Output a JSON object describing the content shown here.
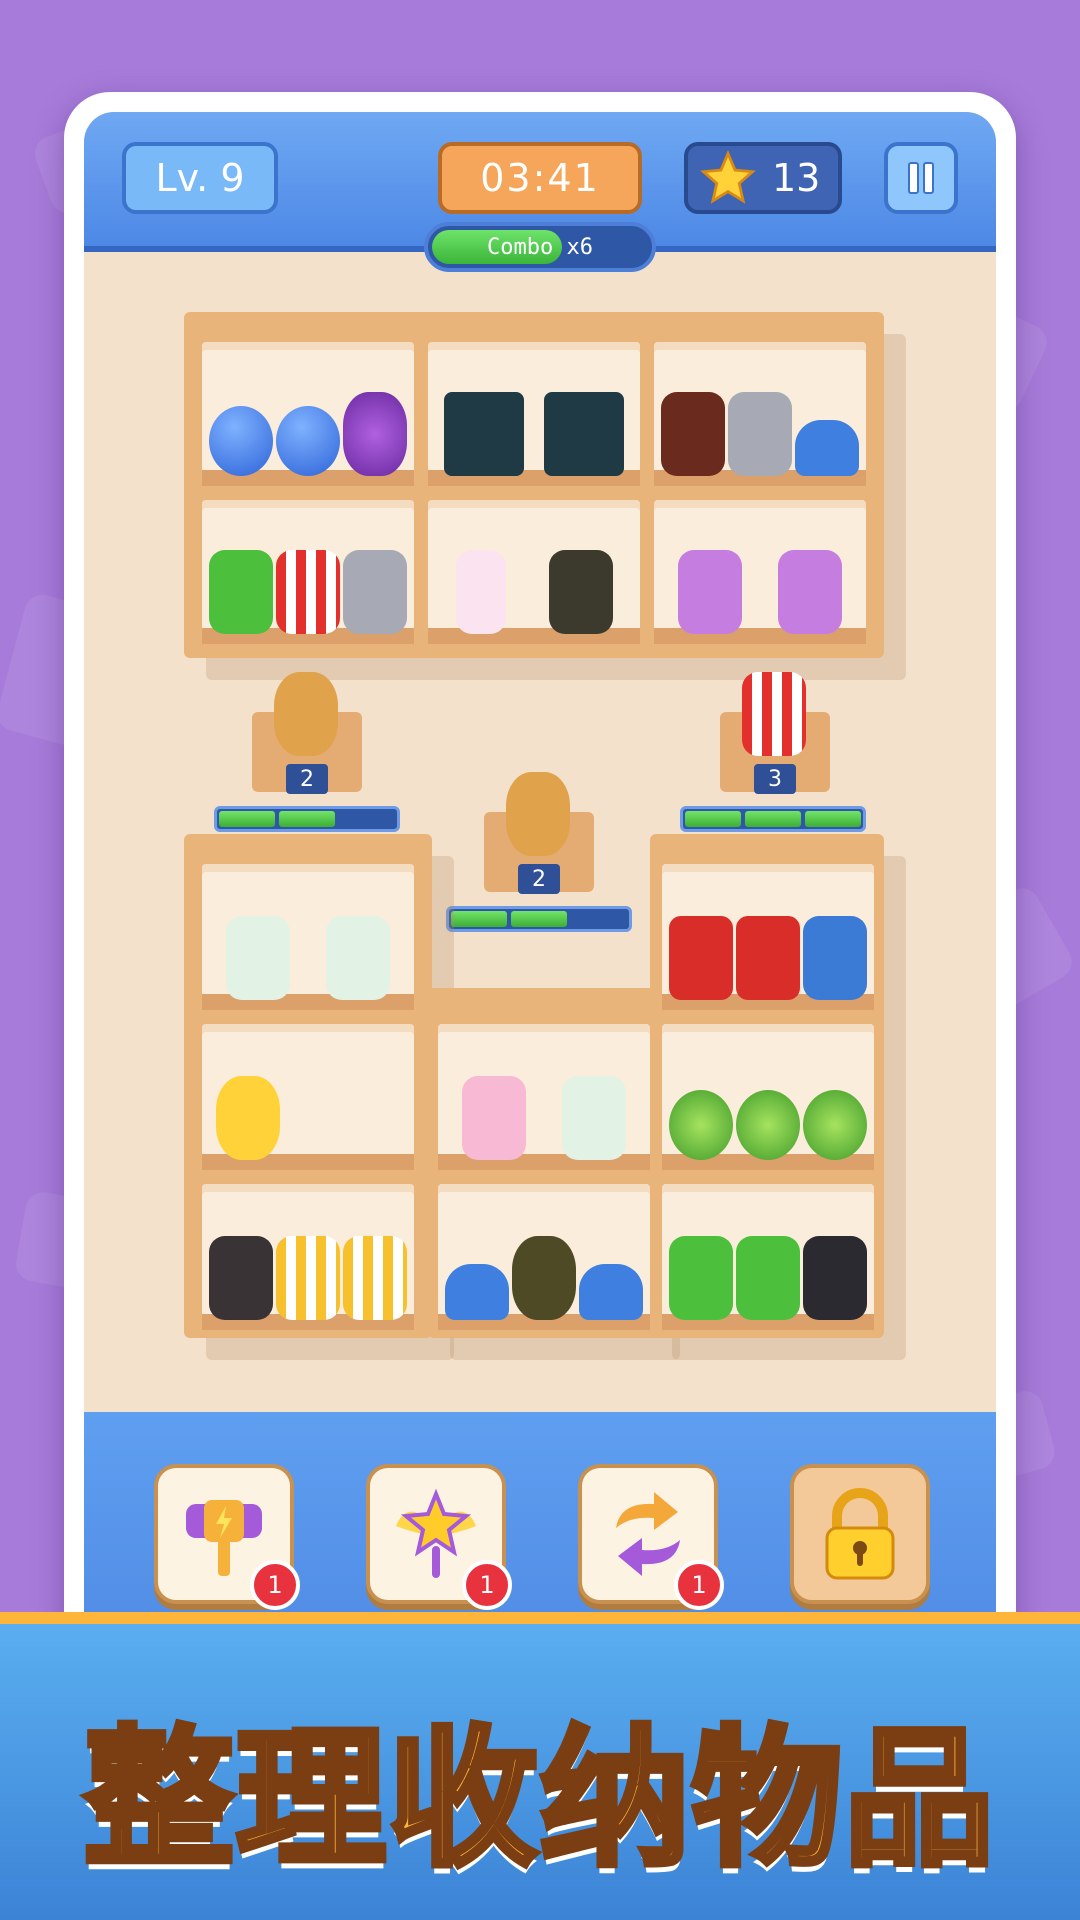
{
  "header": {
    "level": "Lv. 9",
    "timer": "03:41",
    "stars": "13",
    "combo": "Combo x6",
    "combo_progress": 0.6
  },
  "pedestals": {
    "left": {
      "count": "2",
      "segments_filled": 2,
      "segments_total": 3
    },
    "middle": {
      "count": "2",
      "segments_filled": 2,
      "segments_total": 3
    },
    "right": {
      "count": "3",
      "segments_filled": 3,
      "segments_total": 3
    }
  },
  "tools": [
    {
      "name": "hammer",
      "count": "1"
    },
    {
      "name": "magic-wand",
      "count": "1"
    },
    {
      "name": "shuffle",
      "count": "1"
    },
    {
      "name": "lock"
    }
  ],
  "banner": {
    "title": "整理收纳物品"
  },
  "colors": {
    "accent": "#ffb43a",
    "header": "#4d88e6",
    "wood": "#e9b47a"
  }
}
